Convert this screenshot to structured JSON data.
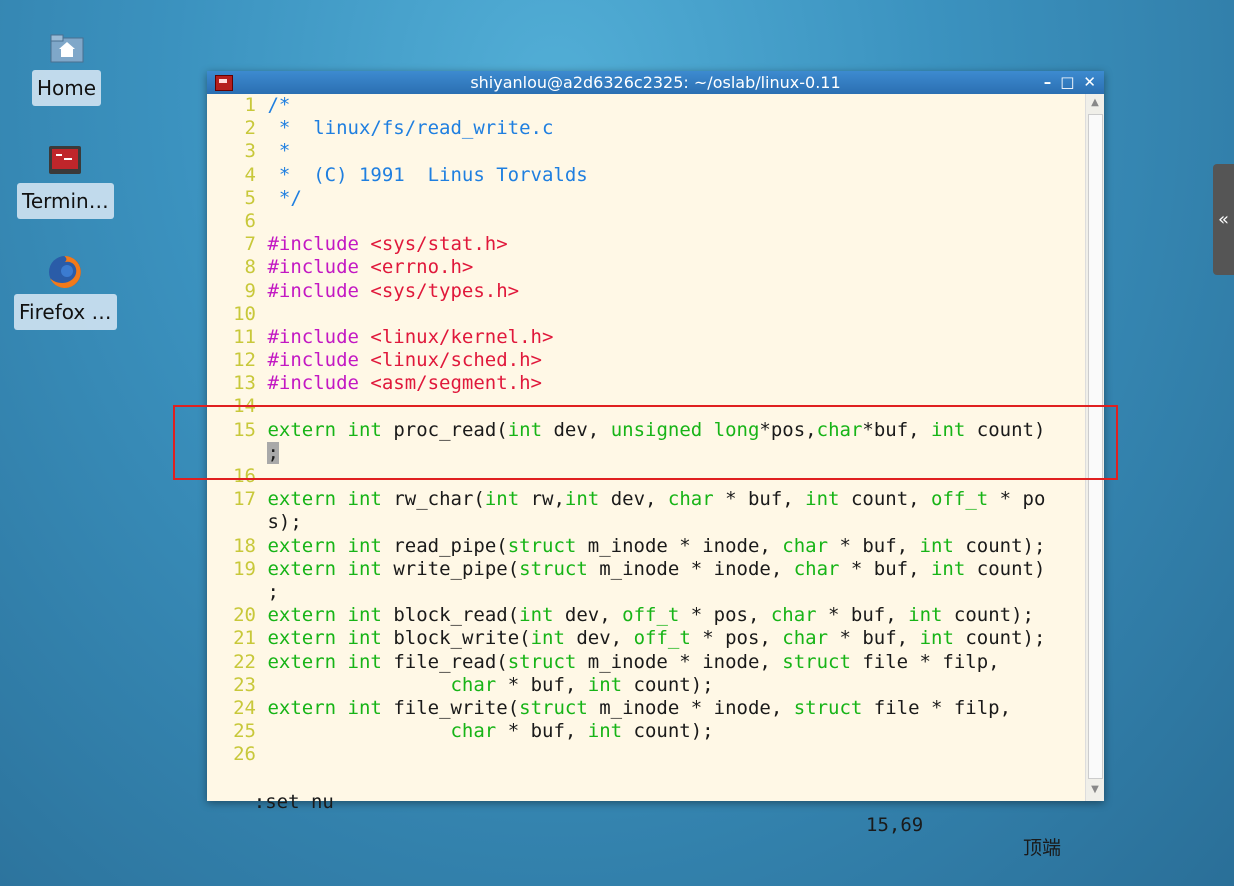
{
  "desktop": {
    "icons": [
      {
        "label": "Home",
        "icon": "home-folder-icon"
      },
      {
        "label": "Termin…",
        "icon": "terminal-icon"
      },
      {
        "label": "Firefox …",
        "icon": "firefox-icon"
      }
    ]
  },
  "window": {
    "title": "shiyanlou@a2d6326c2325: ~/oslab/linux-0.11",
    "controls": {
      "minimize": "–",
      "maximize": "□",
      "close": "✕"
    }
  },
  "editor": {
    "lines": [
      {
        "n": "1",
        "parts": [
          {
            "t": "/*",
            "c": "c"
          }
        ]
      },
      {
        "n": "2",
        "parts": [
          {
            "t": " *  linux/fs/read_write.c",
            "c": "c"
          }
        ]
      },
      {
        "n": "3",
        "parts": [
          {
            "t": " *",
            "c": "c"
          }
        ]
      },
      {
        "n": "4",
        "parts": [
          {
            "t": " *  (C) 1991  Linus Torvalds",
            "c": "c"
          }
        ]
      },
      {
        "n": "5",
        "parts": [
          {
            "t": " */",
            "c": "c"
          }
        ]
      },
      {
        "n": "6",
        "parts": []
      },
      {
        "n": "7",
        "parts": [
          {
            "t": "#include ",
            "c": "pp"
          },
          {
            "t": "<sys/stat.h>",
            "c": "str"
          }
        ]
      },
      {
        "n": "8",
        "parts": [
          {
            "t": "#include ",
            "c": "pp"
          },
          {
            "t": "<errno.h>",
            "c": "str"
          }
        ]
      },
      {
        "n": "9",
        "parts": [
          {
            "t": "#include ",
            "c": "pp"
          },
          {
            "t": "<sys/types.h>",
            "c": "str"
          }
        ]
      },
      {
        "n": "10",
        "parts": []
      },
      {
        "n": "11",
        "parts": [
          {
            "t": "#include ",
            "c": "pp"
          },
          {
            "t": "<linux/kernel.h>",
            "c": "str"
          }
        ]
      },
      {
        "n": "12",
        "parts": [
          {
            "t": "#include ",
            "c": "pp"
          },
          {
            "t": "<linux/sched.h>",
            "c": "str"
          }
        ]
      },
      {
        "n": "13",
        "parts": [
          {
            "t": "#include ",
            "c": "pp"
          },
          {
            "t": "<asm/segment.h>",
            "c": "str"
          }
        ]
      },
      {
        "n": "14",
        "parts": []
      },
      {
        "n": "15",
        "parts": [
          {
            "t": "extern",
            "c": "kw"
          },
          {
            "t": " "
          },
          {
            "t": "int",
            "c": "kw"
          },
          {
            "t": " proc_read("
          },
          {
            "t": "int",
            "c": "kw"
          },
          {
            "t": " dev, "
          },
          {
            "t": "unsigned",
            "c": "kw"
          },
          {
            "t": " "
          },
          {
            "t": "long",
            "c": "kw"
          },
          {
            "t": "*pos,"
          },
          {
            "t": "char",
            "c": "kw"
          },
          {
            "t": "*buf, "
          },
          {
            "t": "int",
            "c": "kw"
          },
          {
            "t": " count)"
          }
        ]
      },
      {
        "n": "",
        "parts": [
          {
            "t": ";",
            "c": "cur"
          }
        ]
      },
      {
        "n": "16",
        "parts": []
      },
      {
        "n": "17",
        "parts": [
          {
            "t": "extern",
            "c": "kw"
          },
          {
            "t": " "
          },
          {
            "t": "int",
            "c": "kw"
          },
          {
            "t": " rw_char("
          },
          {
            "t": "int",
            "c": "kw"
          },
          {
            "t": " rw,"
          },
          {
            "t": "int",
            "c": "kw"
          },
          {
            "t": " dev, "
          },
          {
            "t": "char",
            "c": "kw"
          },
          {
            "t": " * buf, "
          },
          {
            "t": "int",
            "c": "kw"
          },
          {
            "t": " count, "
          },
          {
            "t": "off_t",
            "c": "kw"
          },
          {
            "t": " * po"
          }
        ]
      },
      {
        "n": "",
        "parts": [
          {
            "t": "s);"
          }
        ]
      },
      {
        "n": "18",
        "parts": [
          {
            "t": "extern",
            "c": "kw"
          },
          {
            "t": " "
          },
          {
            "t": "int",
            "c": "kw"
          },
          {
            "t": " read_pipe("
          },
          {
            "t": "struct",
            "c": "kw"
          },
          {
            "t": " m_inode * inode, "
          },
          {
            "t": "char",
            "c": "kw"
          },
          {
            "t": " * buf, "
          },
          {
            "t": "int",
            "c": "kw"
          },
          {
            "t": " count);"
          }
        ]
      },
      {
        "n": "19",
        "parts": [
          {
            "t": "extern",
            "c": "kw"
          },
          {
            "t": " "
          },
          {
            "t": "int",
            "c": "kw"
          },
          {
            "t": " write_pipe("
          },
          {
            "t": "struct",
            "c": "kw"
          },
          {
            "t": " m_inode * inode, "
          },
          {
            "t": "char",
            "c": "kw"
          },
          {
            "t": " * buf, "
          },
          {
            "t": "int",
            "c": "kw"
          },
          {
            "t": " count)"
          }
        ]
      },
      {
        "n": "",
        "parts": [
          {
            "t": ";"
          }
        ]
      },
      {
        "n": "20",
        "parts": [
          {
            "t": "extern",
            "c": "kw"
          },
          {
            "t": " "
          },
          {
            "t": "int",
            "c": "kw"
          },
          {
            "t": " block_read("
          },
          {
            "t": "int",
            "c": "kw"
          },
          {
            "t": " dev, "
          },
          {
            "t": "off_t",
            "c": "kw"
          },
          {
            "t": " * pos, "
          },
          {
            "t": "char",
            "c": "kw"
          },
          {
            "t": " * buf, "
          },
          {
            "t": "int",
            "c": "kw"
          },
          {
            "t": " count);"
          }
        ]
      },
      {
        "n": "21",
        "parts": [
          {
            "t": "extern",
            "c": "kw"
          },
          {
            "t": " "
          },
          {
            "t": "int",
            "c": "kw"
          },
          {
            "t": " block_write("
          },
          {
            "t": "int",
            "c": "kw"
          },
          {
            "t": " dev, "
          },
          {
            "t": "off_t",
            "c": "kw"
          },
          {
            "t": " * pos, "
          },
          {
            "t": "char",
            "c": "kw"
          },
          {
            "t": " * buf, "
          },
          {
            "t": "int",
            "c": "kw"
          },
          {
            "t": " count);"
          }
        ]
      },
      {
        "n": "22",
        "parts": [
          {
            "t": "extern",
            "c": "kw"
          },
          {
            "t": " "
          },
          {
            "t": "int",
            "c": "kw"
          },
          {
            "t": " file_read("
          },
          {
            "t": "struct",
            "c": "kw"
          },
          {
            "t": " m_inode * inode, "
          },
          {
            "t": "struct",
            "c": "kw"
          },
          {
            "t": " file * filp,"
          }
        ]
      },
      {
        "n": "23",
        "parts": [
          {
            "t": "                "
          },
          {
            "t": "char",
            "c": "kw"
          },
          {
            "t": " * buf, "
          },
          {
            "t": "int",
            "c": "kw"
          },
          {
            "t": " count);"
          }
        ]
      },
      {
        "n": "24",
        "parts": [
          {
            "t": "extern",
            "c": "kw"
          },
          {
            "t": " "
          },
          {
            "t": "int",
            "c": "kw"
          },
          {
            "t": " file_write("
          },
          {
            "t": "struct",
            "c": "kw"
          },
          {
            "t": " m_inode * inode, "
          },
          {
            "t": "struct",
            "c": "kw"
          },
          {
            "t": " file * filp,"
          }
        ]
      },
      {
        "n": "25",
        "parts": [
          {
            "t": "                "
          },
          {
            "t": "char",
            "c": "kw"
          },
          {
            "t": " * buf, "
          },
          {
            "t": "int",
            "c": "kw"
          },
          {
            "t": " count);"
          }
        ]
      },
      {
        "n": "26",
        "parts": []
      }
    ]
  },
  "statusline": {
    "command": ":set nu",
    "position": "15,69",
    "scroll": "顶端"
  },
  "side_handle": {
    "label": "«"
  },
  "colors": {
    "comment": "#1f7fe0",
    "preproc": "#c318c3",
    "string": "#e0183b",
    "keyword": "#17b417",
    "line_number": "#c8c83a",
    "highlight_box": "#e02020"
  }
}
